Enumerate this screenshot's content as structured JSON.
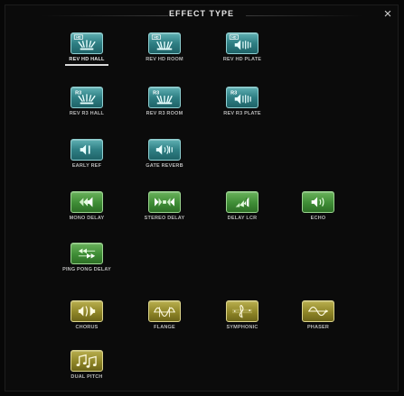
{
  "title": "EFFECT TYPE",
  "close_symbol": "×",
  "selected": "REV HD HALL",
  "effects": [
    {
      "label": "REV HD HALL",
      "color": "teal",
      "icon": "hd-hall-icon"
    },
    {
      "label": "REV HD ROOM",
      "color": "teal",
      "icon": "hd-room-icon"
    },
    {
      "label": "REV HD PLATE",
      "color": "teal",
      "icon": "hd-plate-icon"
    },
    {
      "label": "REV R3 HALL",
      "color": "teal",
      "icon": "r3-hall-icon"
    },
    {
      "label": "REV R3 ROOM",
      "color": "teal",
      "icon": "r3-room-icon"
    },
    {
      "label": "REV R3 PLATE",
      "color": "teal",
      "icon": "r3-plate-icon"
    },
    {
      "label": "EARLY REF",
      "color": "teal",
      "icon": "early-ref-icon"
    },
    {
      "label": "GATE REVERB",
      "color": "teal",
      "icon": "gate-reverb-icon"
    },
    {
      "label": "MONO DELAY",
      "color": "green",
      "icon": "mono-delay-icon"
    },
    {
      "label": "STEREO DELAY",
      "color": "green",
      "icon": "stereo-delay-icon"
    },
    {
      "label": "DELAY LCR",
      "color": "green",
      "icon": "delay-lcr-icon"
    },
    {
      "label": "ECHO",
      "color": "green",
      "icon": "echo-icon"
    },
    {
      "label": "PING PONG DELAY",
      "color": "green",
      "icon": "ping-pong-delay-icon"
    },
    {
      "label": "CHORUS",
      "color": "olive",
      "icon": "chorus-icon"
    },
    {
      "label": "FLANGE",
      "color": "olive",
      "icon": "flange-icon"
    },
    {
      "label": "SYMPHONIC",
      "color": "olive",
      "icon": "symphonic-icon"
    },
    {
      "label": "PHASER",
      "color": "olive",
      "icon": "phaser-icon"
    },
    {
      "label": "DUAL PITCH",
      "color": "olive",
      "icon": "dual-pitch-icon"
    }
  ]
}
